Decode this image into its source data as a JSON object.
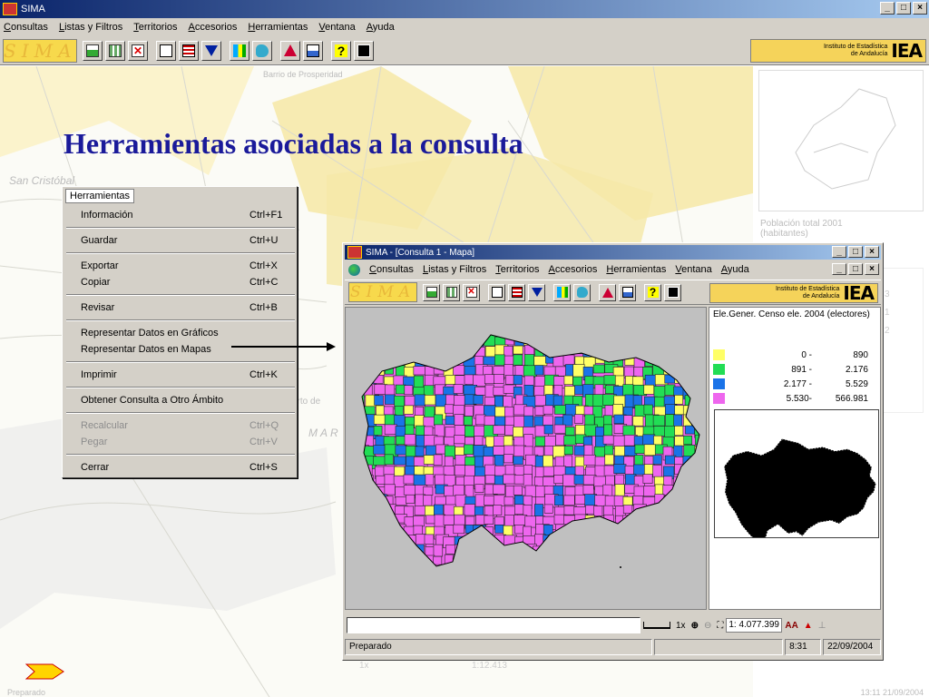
{
  "window": {
    "title": "SIMA",
    "min": "_",
    "max": "□",
    "close": "×"
  },
  "menu": [
    "Consultas",
    "Listas y Filtros",
    "Territorios",
    "Accesorios",
    "Herramientas",
    "Ventana",
    "Ayuda"
  ],
  "iea": {
    "line1": "Instituto de Estadística",
    "line2": "de Andalucía",
    "mark": "IEA"
  },
  "logo": "SIMA",
  "slide_title": "Herramientas asociadas a la consulta",
  "popup": {
    "header": "Herramientas",
    "items": [
      {
        "label": "Información",
        "shortcut": "Ctrl+F1"
      },
      {
        "label": "Guardar",
        "shortcut": "Ctrl+U"
      },
      {
        "label": "Exportar",
        "shortcut": "Ctrl+X"
      },
      {
        "label": "Copiar",
        "shortcut": "Ctrl+C"
      },
      {
        "label": "Revisar",
        "shortcut": "Ctrl+B"
      },
      {
        "label": "Representar Datos en Gráficos",
        "shortcut": ""
      },
      {
        "label": "Representar Datos en Mapas",
        "shortcut": ""
      },
      {
        "label": "Imprimir",
        "shortcut": "Ctrl+K"
      },
      {
        "label": "Obtener Consulta a Otro Ámbito",
        "shortcut": ""
      },
      {
        "label": "Recalcular",
        "shortcut": "Ctrl+Q"
      },
      {
        "label": "Pegar",
        "shortcut": "Ctrl+V"
      },
      {
        "label": "Cerrar",
        "shortcut": "Ctrl+S"
      }
    ]
  },
  "inner": {
    "title": "SIMA - [Consulta 1 - Mapa]",
    "menu": [
      "Consultas",
      "Listas y Filtros",
      "Territorios",
      "Accesorios",
      "Herramientas",
      "Ventana",
      "Ayuda"
    ],
    "legend_title": "Ele.Gener. Censo ele. 2004 (electores)",
    "legend": [
      {
        "color": "#ffff66",
        "low": "0 -",
        "high": "890"
      },
      {
        "color": "#22dd55",
        "low": "891 -",
        "high": "2.176"
      },
      {
        "color": "#1a73e8",
        "low": "2.177 -",
        "high": "5.529"
      },
      {
        "color": "#ee66ee",
        "low": "5.530-",
        "high": "566.981"
      }
    ],
    "zoom": "1x",
    "scale": "1: 4.077.399",
    "status": "Preparado",
    "time": "8:31",
    "date": "22/09/2004"
  },
  "background": {
    "right_label": "Población total 2001 (habitantes)",
    "map_words": [
      "San Cristóbal",
      "MAR",
      "erto de",
      "Barrio de Prosperidad"
    ],
    "ghost_scale": "1:12.413",
    "ghost_zoom": "1x",
    "ghost_nums": [
      "3",
      "1",
      "2"
    ]
  },
  "footer": {
    "left": "Preparado",
    "right": "13:11   21/09/2004"
  }
}
